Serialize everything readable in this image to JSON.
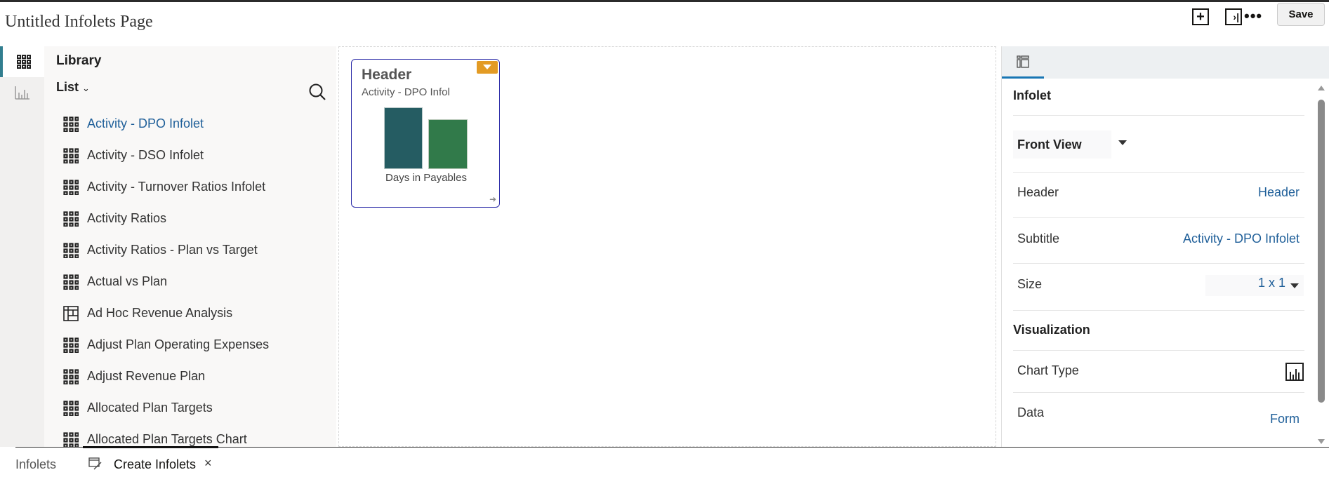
{
  "page": {
    "title": "Untitled Infolets Page"
  },
  "toolbar": {
    "add_icon": "plus-square-icon",
    "panel_icon": "collapse-panel-icon",
    "more_label": "•••",
    "save_label": "Save"
  },
  "library": {
    "title": "Library",
    "view_label": "List",
    "items": [
      {
        "label": "Activity - DPO Infolet",
        "icon": "infolet-grid-icon",
        "selected": true
      },
      {
        "label": "Activity - DSO Infolet",
        "icon": "infolet-grid-icon"
      },
      {
        "label": "Activity - Turnover Ratios Infolet",
        "icon": "infolet-grid-icon"
      },
      {
        "label": "Activity Ratios",
        "icon": "infolet-grid-icon"
      },
      {
        "label": "Activity Ratios - Plan vs Target",
        "icon": "infolet-grid-icon"
      },
      {
        "label": "Actual vs Plan",
        "icon": "infolet-grid-icon"
      },
      {
        "label": "Ad Hoc Revenue Analysis",
        "icon": "form-table-icon"
      },
      {
        "label": "Adjust Plan Operating Expenses",
        "icon": "infolet-grid-icon"
      },
      {
        "label": "Adjust Revenue Plan",
        "icon": "infolet-grid-icon"
      },
      {
        "label": "Allocated Plan Targets",
        "icon": "infolet-grid-icon"
      },
      {
        "label": "Allocated Plan Targets Chart",
        "icon": "infolet-grid-icon"
      }
    ]
  },
  "card": {
    "header": "Header",
    "subtitle": "Activity - DPO Infol",
    "caption": "Days in Payables",
    "bar_colors": [
      "#255c62",
      "#317a4a"
    ],
    "bar_levels": [
      1.0,
      0.81
    ]
  },
  "properties": {
    "section_infolet": "Infolet",
    "view": "Front View",
    "header_label": "Header",
    "header_value": "Header",
    "subtitle_label": "Subtitle",
    "subtitle_value": "Activity - DPO Infolet",
    "size_label": "Size",
    "size_value": "1 x 1",
    "section_visualization": "Visualization",
    "chart_type_label": "Chart Type",
    "data_label": "Data",
    "data_value": "Form"
  },
  "bottom_tabs": {
    "infolets": "Infolets",
    "create": "Create Infolets",
    "close": "×"
  },
  "colors": {
    "accent": "#1876b4",
    "link": "#1f5f99",
    "card_menu": "#e39b24"
  }
}
